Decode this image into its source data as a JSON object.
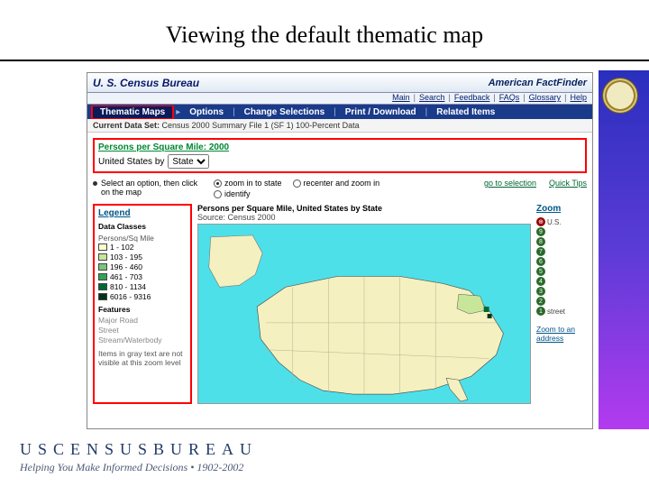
{
  "slide": {
    "title": "Viewing the default thematic map"
  },
  "header": {
    "brand": "U. S. Census Bureau",
    "product": "American FactFinder",
    "links": {
      "main": "Main",
      "search": "Search",
      "feedback": "Feedback",
      "faqs": "FAQs",
      "glossary": "Glossary",
      "help": "Help"
    }
  },
  "tabs": {
    "thematic": "Thematic Maps",
    "options": "Options",
    "change": "Change Selections",
    "print": "Print / Download",
    "related": "Related Items"
  },
  "dataset": {
    "label": "Current Data Set:",
    "value": "Census 2000 Summary File 1 (SF 1) 100-Percent Data"
  },
  "theme": {
    "title": "Persons per Square Mile: 2000",
    "geo_label": "United States by",
    "geo_select": "State",
    "geo_options": [
      "State"
    ]
  },
  "options": {
    "hint": "Select an option, then click on the map",
    "radios": {
      "zoomin": "zoom in to state",
      "recenter": "recenter and zoom in",
      "identify": "identify"
    },
    "selected": "zoomin",
    "links": {
      "goto": "go to selection",
      "quick": "Quick Tips"
    }
  },
  "legend": {
    "title": "Legend",
    "classes_head": "Data Classes",
    "classes_unit": "Persons/Sq Mile",
    "classes": [
      {
        "range": "1 - 102",
        "color": "#ffffcc"
      },
      {
        "range": "103 - 195",
        "color": "#c7e699"
      },
      {
        "range": "196 - 460",
        "color": "#78c679"
      },
      {
        "range": "461 - 703",
        "color": "#31a354"
      },
      {
        "range": "810 - 1134",
        "color": "#006837"
      },
      {
        "range": "6016 - 9316",
        "color": "#00331a"
      }
    ],
    "features_head": "Features",
    "features": [
      "Major Road",
      "Street",
      "Stream/Waterbody"
    ],
    "note": "Items in gray text are not visible at this zoom level"
  },
  "map": {
    "title": "Persons per Square Mile, United States by State",
    "source": "Source: Census 2000"
  },
  "zoom": {
    "title": "Zoom",
    "us_label": "U.S.",
    "street_label": "street",
    "levels": [
      "9",
      "8",
      "7",
      "6",
      "5",
      "4",
      "3",
      "2",
      "1"
    ],
    "address_link": "Zoom to an address"
  },
  "footer": {
    "brand": "USCENSUSBUREAU",
    "tagline": "Helping You Make Informed Decisions • 1902-2002"
  },
  "icons": {
    "seal": "census-seal"
  }
}
